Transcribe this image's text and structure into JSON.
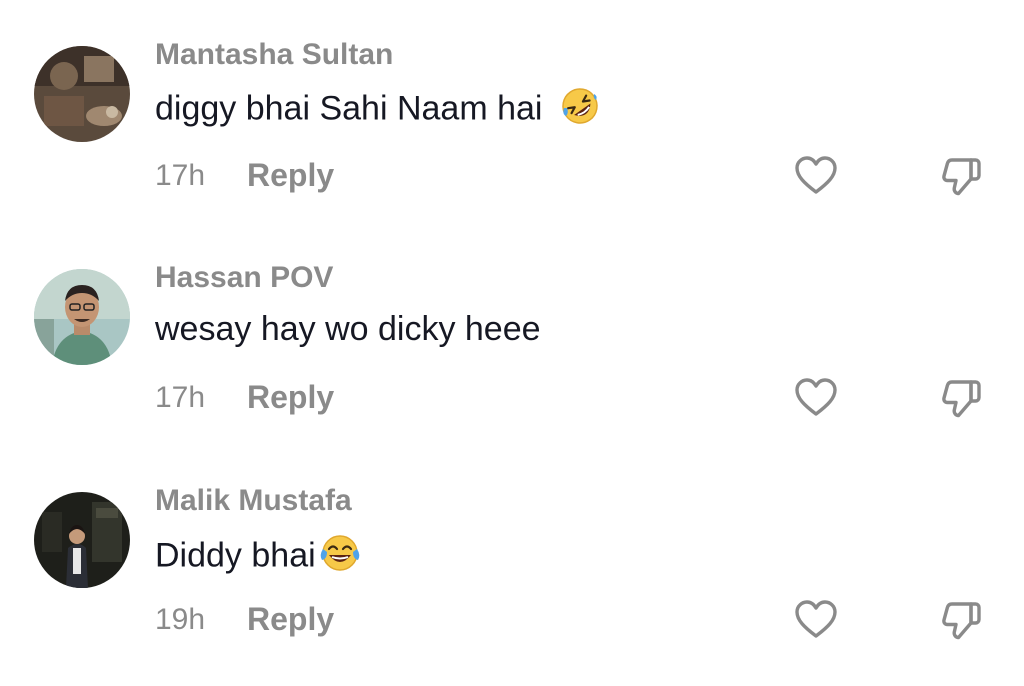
{
  "comments": [
    {
      "username": "Mantasha Sultan",
      "text": "diggy bhai Sahi Naam hai",
      "emoji": "rolling-on-floor-laughing",
      "time": "17h",
      "reply_label": "Reply"
    },
    {
      "username": "Hassan POV",
      "text": "wesay hay wo dicky heee",
      "emoji": "",
      "time": "17h",
      "reply_label": "Reply"
    },
    {
      "username": "Malik Mustafa",
      "text": "Diddy bhai",
      "emoji": "face-with-tears-of-joy",
      "time": "19h",
      "reply_label": "Reply"
    }
  ],
  "icons": {
    "like": "heart-icon",
    "dislike": "thumbs-down-icon"
  },
  "colors": {
    "username": "#8a8a8a",
    "text": "#161823",
    "icon_stroke": "#8a8a8a"
  }
}
